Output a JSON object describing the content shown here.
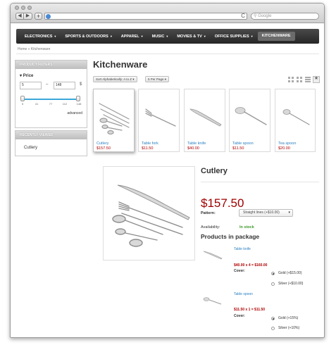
{
  "browser": {
    "nav_back": "◀",
    "nav_forward": "▶",
    "new_tab": "+",
    "reload": "C",
    "search_placeholder": "Google"
  },
  "sitenav": {
    "items": [
      {
        "label": "ELECTRONICS"
      },
      {
        "label": "SPORTS & OUTDOORS"
      },
      {
        "label": "APPAREL"
      },
      {
        "label": "MUSIC"
      },
      {
        "label": "MOVIES & TV"
      },
      {
        "label": "OFFICE SUPPLIES"
      },
      {
        "label": "KITCHENWARE",
        "active": true
      }
    ]
  },
  "breadcrumb": "Home » Kitchenware",
  "filters": {
    "title": "PRODUCT FILTERS",
    "price_label": "Price",
    "min_value": "5",
    "max_value": "148",
    "currency": "$",
    "dash": "–",
    "ticks": [
      "5",
      "41",
      "77",
      "112",
      "148"
    ],
    "advanced": "advanced"
  },
  "recently_viewed": {
    "title": "RECENTLY VIEWED",
    "items": [
      "Cutlery"
    ]
  },
  "main": {
    "title": "Kitchenware",
    "sort_label": "Sort Alphabetically: A to Z",
    "per_page_label": "5 Per Page",
    "products": [
      {
        "name": "Cutlery",
        "price": "$157.50"
      },
      {
        "name": "Table fork",
        "price": "$11.50"
      },
      {
        "name": "Table knife",
        "price": "$40.00"
      },
      {
        "name": "Table spoon",
        "price": "$11.50"
      },
      {
        "name": "Tea spoon",
        "price": "$20.00"
      }
    ]
  },
  "detail": {
    "title": "Cutlery",
    "price": "$157.50",
    "pattern_label": "Pattern:",
    "pattern_value": "Straight lines (+$10.00)",
    "availability_label": "Availability:",
    "availability_value": "In stock",
    "package_title": "Products in package",
    "package": [
      {
        "name": "Table knife",
        "calc": "$40.00 x 4 = $160.00",
        "cover_label": "Cover:",
        "options": [
          "Gold (+$15.00)",
          "Silver (+$10.00)"
        ]
      },
      {
        "name": "Table spoon",
        "calc": "$11.50 x 1 = $11.50",
        "cover_label": "Cover:",
        "options": [
          "Gold (+15%)",
          "Silver (+10%)"
        ]
      }
    ]
  },
  "colors": {
    "link": "#2a7fc1",
    "price": "#b00000",
    "instock": "#3c9a2a",
    "slider": "#3aa7d9"
  }
}
